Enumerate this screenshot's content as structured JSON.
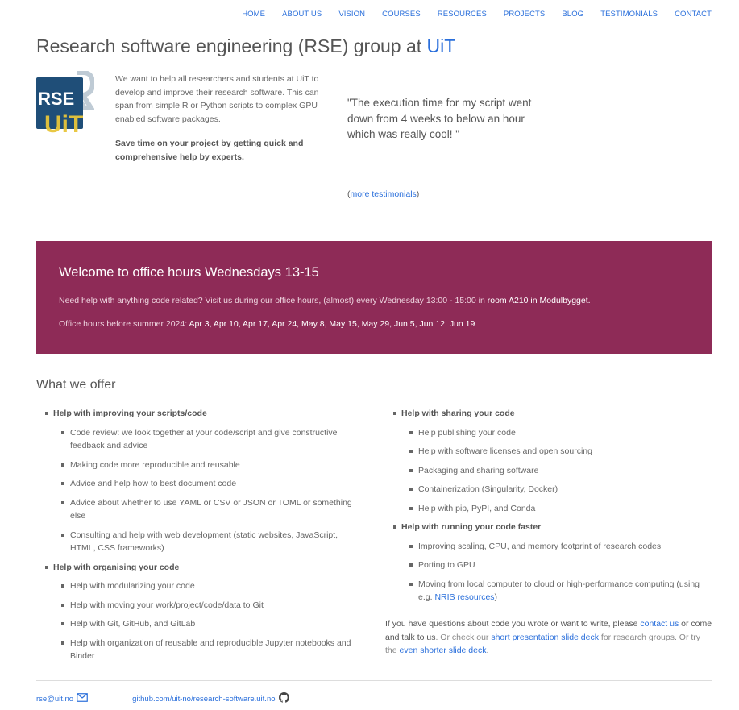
{
  "nav": {
    "items": [
      "HOME",
      "ABOUT US",
      "VISION",
      "COURSES",
      "RESOURCES",
      "PROJECTS",
      "BLOG",
      "TESTIMONIALS",
      "CONTACT"
    ]
  },
  "header": {
    "title_prefix": "Research software engineering (RSE) group at ",
    "title_link": "UiT"
  },
  "logo": {
    "text_rse": "RSE",
    "text_uit": "UiT"
  },
  "intro": {
    "paragraph": "We want to help all researchers and students at UiT to develop and improve their research software. This can span from simple R or Python scripts to complex GPU enabled software packages.",
    "bold": "Save time on your project by getting quick and comprehensive help by experts."
  },
  "testimonial": {
    "quote": "\"The execution time for my script went down from 4 weeks to below an hour which was really cool! \"",
    "more_open": "(",
    "more_link": "more testimonials",
    "more_close": ")"
  },
  "office": {
    "heading": "Welcome to office hours Wednesdays 13-15",
    "line1_text": "Need help with anything code related? Visit us during our office hours, (almost) every Wednesday 13:00 - 15:00 in ",
    "line1_link": "room A210 in Modulbygget",
    "line1_end": ".",
    "line2_text": "Office hours before summer 2024: ",
    "line2_dates": "Apr 3, Apr 10, Apr 17, Apr 24, May 8, May 15, May 29, Jun 5, Jun 12, Jun 19",
    "bg_color": "#8e2b57"
  },
  "offer": {
    "title": "What we offer",
    "left": [
      {
        "label": "Help with improving your scripts/code",
        "items": [
          "Code review: we look together at your code/script and give constructive feedback and advice",
          "Making code more reproducible and reusable",
          "Advice and help how to best document code",
          "Advice about whether to use YAML or CSV or JSON or TOML or something else",
          "Consulting and help with web development (static websites, JavaScript, HTML, CSS frameworks)"
        ]
      },
      {
        "label": "Help with organising your code",
        "items": [
          "Help with modularizing your code",
          "Help with moving your work/project/code/data to Git",
          "Help with Git, GitHub, and GitLab",
          "Help with organization of reusable and reproducible Jupyter notebooks and Binder"
        ]
      }
    ],
    "right": [
      {
        "label": "Help with sharing your code",
        "items": [
          "Help publishing your code",
          "Help with software licenses and open sourcing",
          "Packaging and sharing software",
          "Containerization (Singularity, Docker)",
          "Help with pip, PyPI, and Conda"
        ]
      },
      {
        "label": "Help with running your code faster",
        "items": [
          "Improving scaling, CPU, and memory footprint of research codes",
          "Porting to GPU"
        ],
        "last_item_prefix": "Moving from local computer to cloud or high-performance computing (using e.g. ",
        "last_item_link": "NRIS resources",
        "last_item_suffix": ")"
      }
    ],
    "contact": {
      "t1": "If you have questions about code you wrote or want to write, please ",
      "link1": "contact us",
      "t2": " or come and talk to us",
      "t3": ". Or check our ",
      "link2": "short presentation slide deck",
      "t4": " for research groups. Or try the ",
      "link3": "even shorter slide deck",
      "t5": "."
    }
  },
  "footer": {
    "email": "rse@uit.no",
    "github": "github.com/uit-no/research-software.uit.no",
    "email_icon": "envelope-icon",
    "github_icon": "github-icon"
  },
  "colors": {
    "link": "#2a6fdb",
    "banner": "#8e2b57",
    "logo_dark": "#1f4e78",
    "logo_yellow": "#e8c63a"
  }
}
